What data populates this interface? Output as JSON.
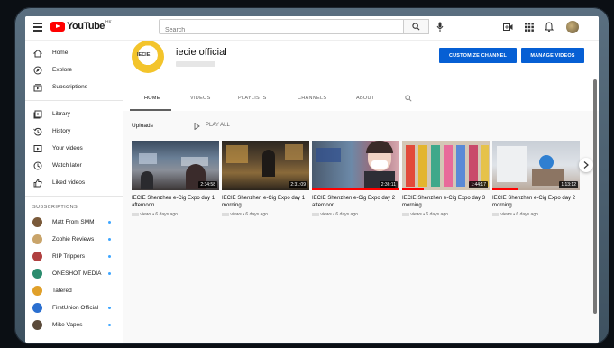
{
  "topbar": {
    "logo_text": "YouTube",
    "logo_region": "HK",
    "search_placeholder": "Search"
  },
  "sidebar": {
    "items": [
      {
        "label": "Home",
        "icon": "home-icon"
      },
      {
        "label": "Explore",
        "icon": "compass-icon"
      },
      {
        "label": "Subscriptions",
        "icon": "subscriptions-icon"
      },
      {
        "label": "Library",
        "icon": "library-icon"
      },
      {
        "label": "History",
        "icon": "history-icon"
      },
      {
        "label": "Your videos",
        "icon": "your-videos-icon"
      },
      {
        "label": "Watch later",
        "icon": "clock-icon"
      },
      {
        "label": "Liked videos",
        "icon": "thumbs-up-icon"
      }
    ],
    "subscriptions_heading": "SUBSCRIPTIONS",
    "subscriptions": [
      {
        "label": "Matt From SMM",
        "color": "#7a5a3a"
      },
      {
        "label": "Zophie Reviews",
        "color": "#c9a46a"
      },
      {
        "label": "RIP Trippers",
        "color": "#b04040"
      },
      {
        "label": "ONESHOT MEDIA",
        "color": "#2b8c6e"
      },
      {
        "label": "Tatered",
        "color": "#e0a02a"
      },
      {
        "label": "FirstUnion Official",
        "color": "#2a6fd0"
      },
      {
        "label": "Mike Vapes",
        "color": "#5a4a3a"
      }
    ]
  },
  "channel": {
    "name": "iecie official",
    "avatar_text": "IECIE",
    "customize_label": "CUSTOMIZE CHANNEL",
    "manage_label": "MANAGE VIDEOS",
    "tabs": [
      "HOME",
      "VIDEOS",
      "PLAYLISTS",
      "CHANNELS",
      "ABOUT"
    ]
  },
  "uploads": {
    "label": "Uploads",
    "play_all": "PLAY ALL",
    "videos": [
      {
        "title": "IECIE Shenzhen e-Cig Expo day 1 afternoon",
        "duration": "2:34:58",
        "meta": "views • 6 days ago",
        "progress": 0.0
      },
      {
        "title": "IECIE Shenzhen e-Cig Expo day 1 morning",
        "duration": "2:31:09",
        "meta": "views • 6 days ago",
        "progress": 0.0
      },
      {
        "title": "IECIE Shenzhen e-Cig Expo day 2 afternoon",
        "duration": "2:36:11",
        "meta": "views • 6 days ago",
        "progress": 1.0
      },
      {
        "title": "IECIE Shenzhen e-Cig Expo day 3 morning",
        "duration": "1:44:17",
        "meta": "views • 6 days ago",
        "progress": 0.25
      },
      {
        "title": "IECIE Shenzhen e-Cig Expo day 2 morning",
        "duration": "1:13:12",
        "meta": "views • 6 days ago",
        "progress": 0.3
      }
    ]
  }
}
